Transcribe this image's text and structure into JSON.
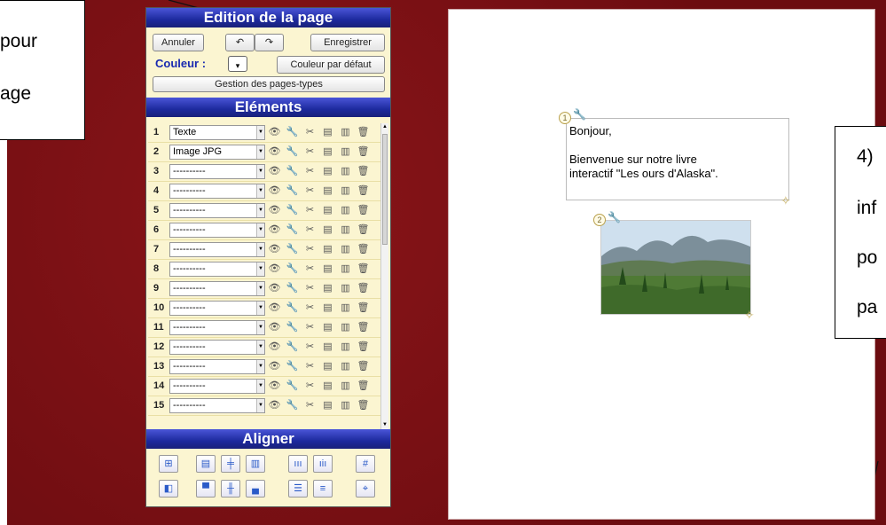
{
  "callout_left": {
    "line1": "pour",
    "line2": "age"
  },
  "callout_right": {
    "lines": [
      "4)",
      "inf",
      "po",
      "pa"
    ]
  },
  "panel": {
    "title": "Edition de la page",
    "cancel_label": "Annuler",
    "save_label": "Enregistrer",
    "color_label": "Couleur :",
    "default_color_label": "Couleur par défaut",
    "page_types_label": "Gestion des pages-types",
    "elements_title": "Eléments",
    "align_title": "Aligner"
  },
  "rows": [
    {
      "n": "1",
      "v": "Texte"
    },
    {
      "n": "2",
      "v": "Image JPG"
    },
    {
      "n": "3",
      "v": "----------"
    },
    {
      "n": "4",
      "v": "----------"
    },
    {
      "n": "5",
      "v": "----------"
    },
    {
      "n": "6",
      "v": "----------"
    },
    {
      "n": "7",
      "v": "----------"
    },
    {
      "n": "8",
      "v": "----------"
    },
    {
      "n": "9",
      "v": "----------"
    },
    {
      "n": "10",
      "v": "----------"
    },
    {
      "n": "11",
      "v": "----------"
    },
    {
      "n": "12",
      "v": "----------"
    },
    {
      "n": "13",
      "v": "----------"
    },
    {
      "n": "14",
      "v": "----------"
    },
    {
      "n": "15",
      "v": "----------"
    }
  ],
  "page": {
    "badge1": "1",
    "badge2": "2",
    "text_line1": "Bonjour,",
    "text_line2": "Bienvenue sur notre livre",
    "text_line3": "interactif \"Les ours d'Alaska\"."
  },
  "colors": {
    "frame": "#7a0f12",
    "header": "#1d2a9e",
    "panel_bg": "#fbf5d1"
  }
}
